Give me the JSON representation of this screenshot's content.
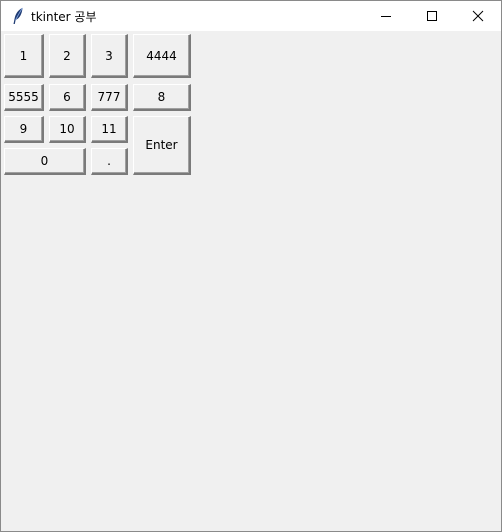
{
  "window": {
    "title": "tkinter 공부",
    "icon": "feather-icon",
    "controls": [
      "minimize-icon",
      "maximize-icon",
      "close-icon"
    ]
  },
  "keypad": {
    "k1": "1",
    "k2": "2",
    "k3": "3",
    "k4444": "4444",
    "k5555": "5555",
    "k6": "6",
    "k777": "777",
    "k8": "8",
    "k9": "9",
    "k10": "10",
    "k11": "11",
    "enter": "Enter",
    "k0": "0",
    "dot": "."
  }
}
